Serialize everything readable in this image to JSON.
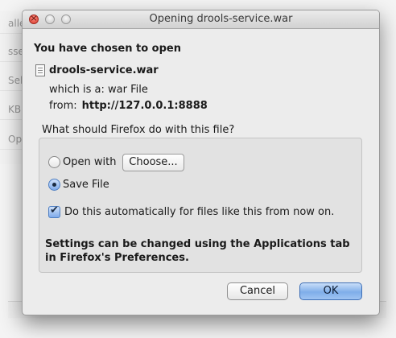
{
  "background": {
    "items": [
      "alle",
      "sse",
      "Sel",
      "KB",
      "Op"
    ]
  },
  "dialog": {
    "title": "Opening drools-service.war",
    "heading": "You have chosen to open",
    "file_icon": "document-icon",
    "filename": "drools-service.war",
    "which_is_label": "which is a:",
    "file_type": "war File",
    "from_label": "from:",
    "from_host": "http://127.0.0.1:8888",
    "question": "What should Firefox do with this file?",
    "open_with_label": "Open with",
    "choose_button": "Choose...",
    "save_file_label": "Save File",
    "selected_option": "Save File",
    "auto_checkbox_label": "Do this automatically for files like this from now on.",
    "auto_checkbox_checked": true,
    "note": "Settings can be changed using the Applications tab in Firefox's Preferences.",
    "cancel_button": "Cancel",
    "ok_button": "OK"
  },
  "colors": {
    "dialog_bg": "#ececec",
    "default_button": "#7faee9",
    "close_button": "#d83a2c"
  }
}
